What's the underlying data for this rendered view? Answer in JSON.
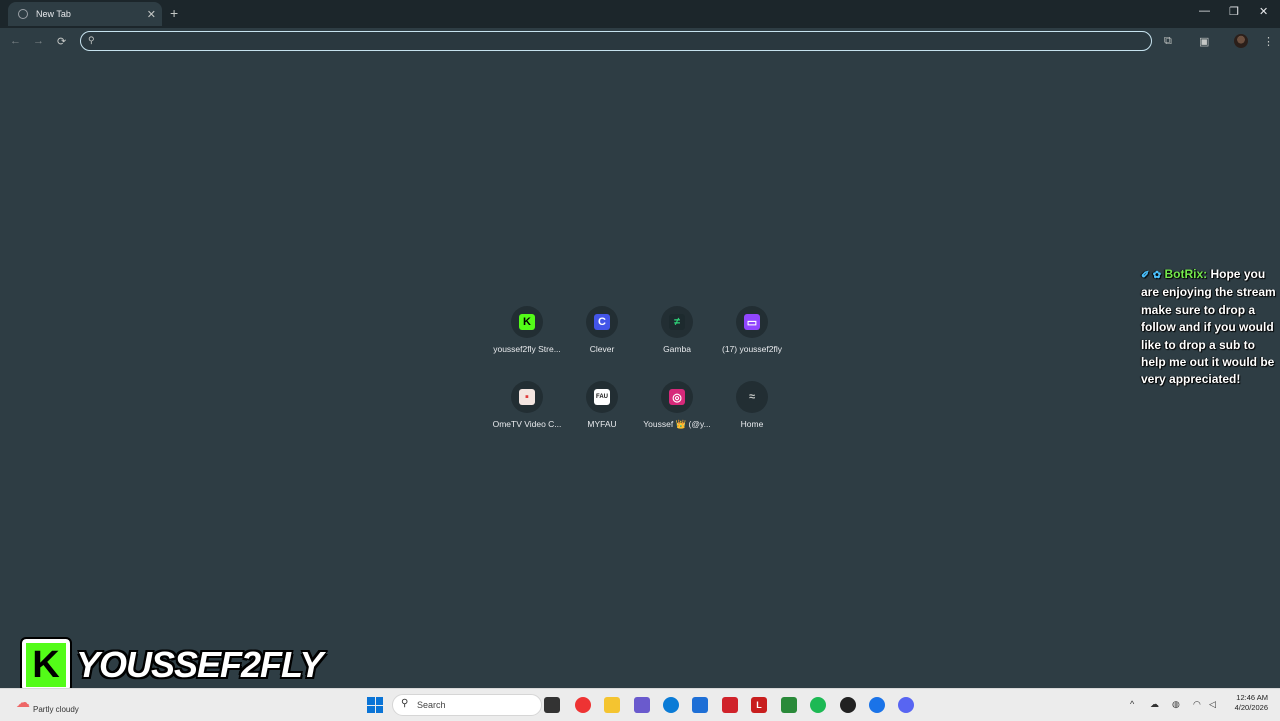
{
  "tab": {
    "title": "New Tab"
  },
  "window_controls": {
    "minimize": "—",
    "restore": "❐",
    "close": "✕"
  },
  "toolbar": {
    "back": "←",
    "forward": "→",
    "reload": "⟳",
    "search_icon": "🔍",
    "address_value": "",
    "extensions_icon": "⧉",
    "sidepanel_icon": "▣",
    "menu_icon": "⋮"
  },
  "shortcuts": [
    {
      "label": "youssef2fly Stre...",
      "icon": "kick-icon",
      "glyph": "K",
      "color": "#53fc18",
      "glyph_color": "#000000"
    },
    {
      "label": "Clever",
      "icon": "clever-icon",
      "glyph": "C",
      "color": "#4355e8",
      "glyph_color": "#ffffff"
    },
    {
      "label": "Gamba",
      "icon": "gamba-icon",
      "glyph": "≠",
      "color": "#1d2a2e",
      "glyph_color": "#2fd67a"
    },
    {
      "label": "(17) youssef2fly",
      "icon": "twitch-icon",
      "glyph": "▭",
      "color": "#9146ff",
      "glyph_color": "#ffffff"
    },
    {
      "label": "OmeTV Video C...",
      "icon": "ometv-icon",
      "glyph": "▪",
      "color": "#f3e5e0",
      "glyph_color": "#e03a3a"
    },
    {
      "label": "MYFAU",
      "icon": "myfau-icon",
      "glyph": "FAU",
      "color": "#ffffff",
      "glyph_color": "#111111"
    },
    {
      "label": "Youssef 👑 (@y...",
      "icon": "instagram-icon",
      "glyph": "◎",
      "color": "#d6297a",
      "glyph_color": "#ffffff"
    },
    {
      "label": "Home",
      "icon": "home-icon",
      "glyph": "≈",
      "color": "#222e33",
      "glyph_color": "#c4c7c5"
    }
  ],
  "chat": {
    "username": "BotRix:",
    "message": "Hope you are enjoying the stream make sure to drop a follow and if you would like to drop a sub to help me out it would be very appreciated!"
  },
  "overlay": {
    "logo_letter": "K",
    "channel_name": "YOUSSEF2FLY"
  },
  "taskbar": {
    "weather": "Partly cloudy",
    "search_label": "Search",
    "time": "12:46 AM",
    "date": "4/20/2026",
    "tray_chevron": "^"
  }
}
